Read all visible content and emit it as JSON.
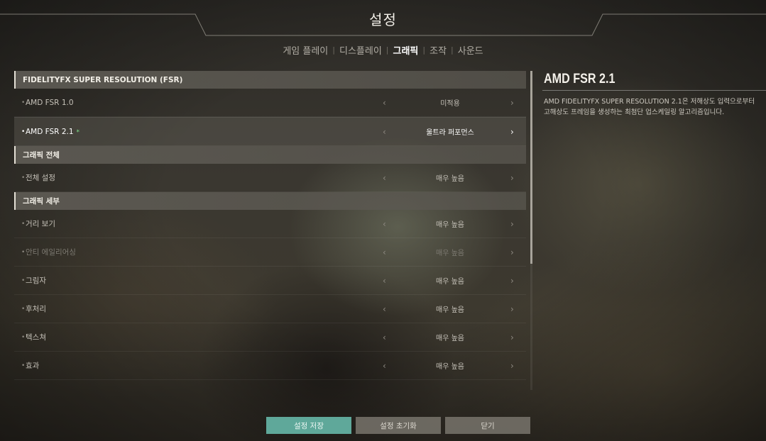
{
  "header": {
    "title": "설정"
  },
  "tabs": [
    {
      "label": "게임 플레이",
      "active": false
    },
    {
      "label": "디스플레이",
      "active": false
    },
    {
      "label": "그래픽",
      "active": true
    },
    {
      "label": "조작",
      "active": false
    },
    {
      "label": "사운드",
      "active": false
    }
  ],
  "sections": {
    "fsr": {
      "title": "FIDELITYFX SUPER RESOLUTION (FSR)",
      "rows": [
        {
          "label": "AMD FSR 1.0",
          "value": "미적용"
        },
        {
          "label": "AMD FSR 2.1",
          "value": "울트라 퍼포먼스",
          "star": "*"
        }
      ]
    },
    "overall": {
      "title": "그래픽 전체",
      "rows": [
        {
          "label": "전체 설정",
          "value": "매우 높음"
        }
      ]
    },
    "detail": {
      "title": "그래픽 세부",
      "rows": [
        {
          "label": "거리 보기",
          "value": "매우 높음"
        },
        {
          "label": "안티 에일리어싱",
          "value": "매우 높음"
        },
        {
          "label": "그림자",
          "value": "매우 높음"
        },
        {
          "label": "후처리",
          "value": "매우 높음"
        },
        {
          "label": "텍스쳐",
          "value": "매우 높음"
        },
        {
          "label": "효과",
          "value": "매우 높음"
        }
      ]
    }
  },
  "glyphs": {
    "bullet": "•",
    "arrow_left": "‹",
    "arrow_right": "›",
    "tab_sep": "|"
  },
  "description": {
    "title": "AMD FSR 2.1",
    "text": "AMD FIDELITYFX SUPER RESOLUTION 2.1은 저해상도 입력으로부터 고해상도 프레임을 생성하는 최첨단 업스케일링 알고리즘입니다."
  },
  "buttons": {
    "save": "설정 저장",
    "reset": "설정 초기화",
    "close": "닫기"
  },
  "colors": {
    "accent": "#5fa89a",
    "star": "#7ee28a"
  }
}
